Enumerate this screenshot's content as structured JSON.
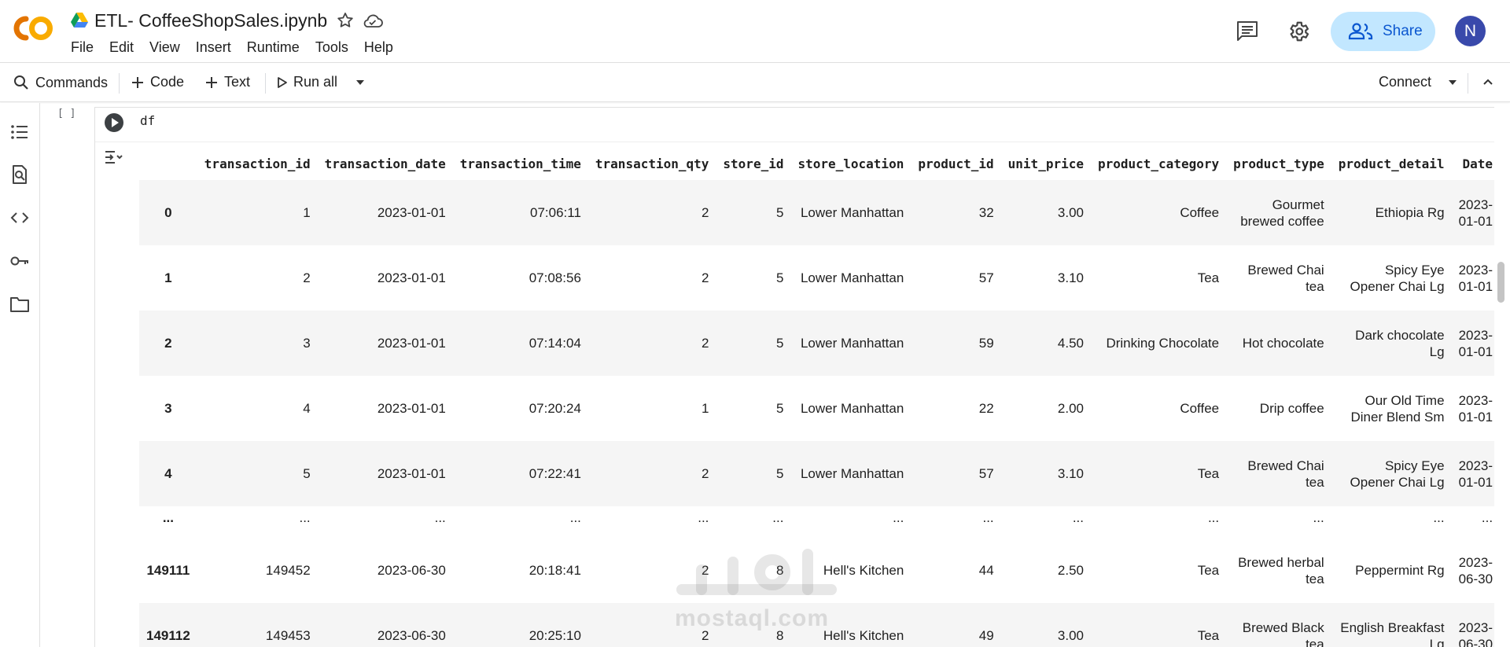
{
  "header": {
    "title": "ETL- CoffeeShopSales.ipynb",
    "menu": [
      "File",
      "Edit",
      "View",
      "Insert",
      "Runtime",
      "Tools",
      "Help"
    ],
    "share_label": "Share",
    "avatar_initial": "N"
  },
  "toolbar": {
    "commands_label": "Commands",
    "code_label": "Code",
    "text_label": "Text",
    "run_all_label": "Run all",
    "connect_label": "Connect"
  },
  "cell": {
    "bracket": "[ ]",
    "code": "df"
  },
  "table": {
    "columns": [
      "",
      "transaction_id",
      "transaction_date",
      "transaction_time",
      "transaction_qty",
      "store_id",
      "store_location",
      "product_id",
      "unit_price",
      "product_category",
      "product_type",
      "product_detail",
      "Date"
    ],
    "rows": [
      [
        "0",
        "1",
        "2023-01-01",
        "07:06:11",
        "2",
        "5",
        "Lower Manhattan",
        "32",
        "3.00",
        "Coffee",
        "Gourmet brewed coffee",
        "Ethiopia Rg",
        "2023-01-01"
      ],
      [
        "1",
        "2",
        "2023-01-01",
        "07:08:56",
        "2",
        "5",
        "Lower Manhattan",
        "57",
        "3.10",
        "Tea",
        "Brewed Chai tea",
        "Spicy Eye Opener Chai Lg",
        "2023-01-01"
      ],
      [
        "2",
        "3",
        "2023-01-01",
        "07:14:04",
        "2",
        "5",
        "Lower Manhattan",
        "59",
        "4.50",
        "Drinking Chocolate",
        "Hot chocolate",
        "Dark chocolate Lg",
        "2023-01-01"
      ],
      [
        "3",
        "4",
        "2023-01-01",
        "07:20:24",
        "1",
        "5",
        "Lower Manhattan",
        "22",
        "2.00",
        "Coffee",
        "Drip coffee",
        "Our Old Time Diner Blend Sm",
        "2023-01-01"
      ],
      [
        "4",
        "5",
        "2023-01-01",
        "07:22:41",
        "2",
        "5",
        "Lower Manhattan",
        "57",
        "3.10",
        "Tea",
        "Brewed Chai tea",
        "Spicy Eye Opener Chai Lg",
        "2023-01-01"
      ],
      [
        "...",
        "...",
        "...",
        "...",
        "...",
        "...",
        "...",
        "...",
        "...",
        "...",
        "...",
        "...",
        "..."
      ],
      [
        "149111",
        "149452",
        "2023-06-30",
        "20:18:41",
        "2",
        "8",
        "Hell's Kitchen",
        "44",
        "2.50",
        "Tea",
        "Brewed herbal tea",
        "Peppermint Rg",
        "2023-06-30"
      ],
      [
        "149112",
        "149453",
        "2023-06-30",
        "20:25:10",
        "2",
        "8",
        "Hell's Kitchen",
        "49",
        "3.00",
        "Tea",
        "Brewed Black tea",
        "English Breakfast Lg",
        "2023-06-30"
      ]
    ]
  },
  "watermark": "mostaql.com",
  "colors": {
    "share_bg": "#c2e7ff",
    "share_text": "#0b57d0",
    "avatar_bg": "#3949ab",
    "row_stripe": "#f5f5f5",
    "logo_orange": "#f9ab00",
    "logo_dark_orange": "#e37400"
  },
  "icons": [
    "colab-logo-icon",
    "drive-icon",
    "star-icon",
    "cloud-icon",
    "comment-icon",
    "gear-icon",
    "people-icon",
    "search-icon",
    "plus-icon",
    "play-icon",
    "chevron-down-icon",
    "chevron-up-icon",
    "toc-icon",
    "find-icon",
    "code-icon",
    "key-icon",
    "folder-icon",
    "output-toggle-icon"
  ]
}
